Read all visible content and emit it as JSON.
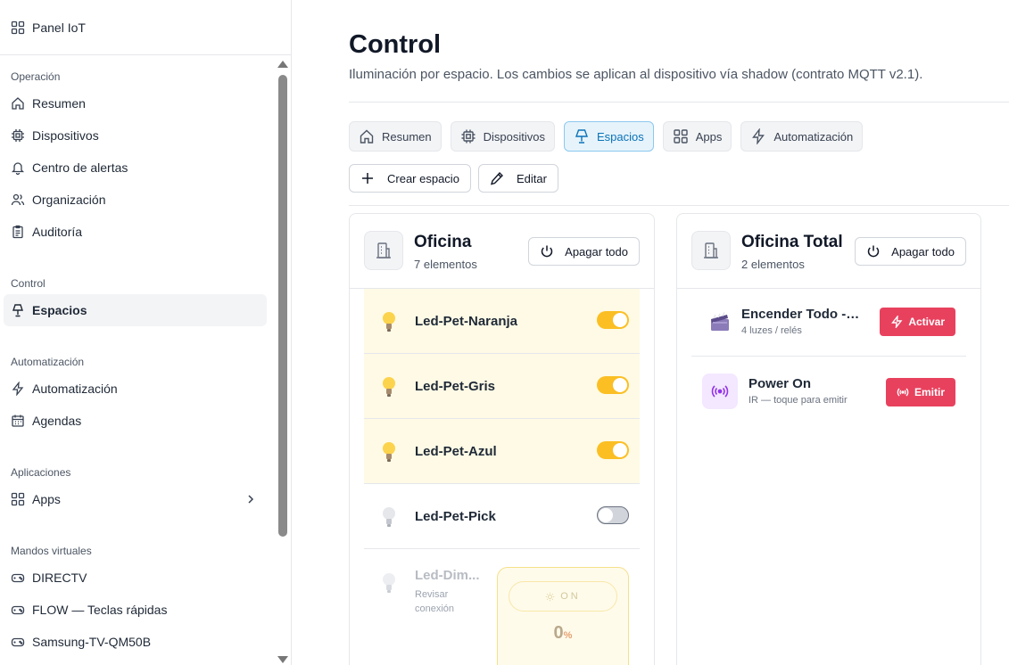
{
  "sidebar": {
    "brand": "Panel IoT",
    "groups": [
      {
        "title": "Operación",
        "items": [
          {
            "label": "Resumen",
            "icon": "home-icon"
          },
          {
            "label": "Dispositivos",
            "icon": "chip-icon"
          },
          {
            "label": "Centro de alertas",
            "icon": "bell-icon"
          },
          {
            "label": "Organización",
            "icon": "users-icon"
          },
          {
            "label": "Auditoría",
            "icon": "clipboard-icon"
          }
        ]
      },
      {
        "title": "Control",
        "items": [
          {
            "label": "Espacios",
            "icon": "lamp-icon",
            "active": true
          }
        ]
      },
      {
        "title": "Automatización",
        "items": [
          {
            "label": "Automatización",
            "icon": "lightning-icon"
          },
          {
            "label": "Agendas",
            "icon": "calendar-icon"
          }
        ]
      },
      {
        "title": "Aplicaciones",
        "items": [
          {
            "label": "Apps",
            "icon": "grid-icon"
          }
        ]
      },
      {
        "title": "Mandos virtuales",
        "items": [
          {
            "label": "DIRECTV",
            "icon": "gamepad-icon"
          },
          {
            "label": "FLOW — Teclas rápidas",
            "icon": "gamepad-icon"
          },
          {
            "label": "Samsung-TV-QM50B",
            "icon": "gamepad-icon"
          }
        ]
      }
    ]
  },
  "header": {
    "title": "Control",
    "subtitle": "Iluminación por espacio. Los cambios se aplican al dispositivo vía shadow (contrato MQTT v2.1)."
  },
  "tabs": [
    {
      "label": "Resumen",
      "icon": "home-icon"
    },
    {
      "label": "Dispositivos",
      "icon": "chip-icon"
    },
    {
      "label": "Espacios",
      "icon": "lamp-icon",
      "active": true
    },
    {
      "label": "Apps",
      "icon": "grid-icon"
    },
    {
      "label": "Automatización",
      "icon": "lightning-icon"
    }
  ],
  "actions": {
    "create_label": "Crear espacio",
    "edit_label": "Editar"
  },
  "spaces": [
    {
      "title": "Oficina",
      "count": "7 elementos",
      "power_label": "Apagar todo",
      "devices": [
        {
          "name": "Led-Pet-Naranja",
          "on": true
        },
        {
          "name": "Led-Pet-Gris",
          "on": true
        },
        {
          "name": "Led-Pet-Azul",
          "on": true
        },
        {
          "name": "Led-Pet-Pick",
          "on": false
        }
      ],
      "dimmer": {
        "name": "Led-Dim...",
        "status": "Revisar conexión",
        "on_label": "ON",
        "value": "0",
        "unit": "%"
      }
    },
    {
      "title": "Oficina Total",
      "count": "2 elementos",
      "power_label": "Apagar todo",
      "scenes": [
        {
          "title": "Encender Todo - I...",
          "sub": "4 luzes / relés",
          "button": "Activar"
        },
        {
          "title": "Power On",
          "sub": "IR — toque para emitir",
          "button": "Emitir"
        }
      ]
    }
  ],
  "colors": {
    "accent": "#0b73b8",
    "toggle_on": "#fbbf24",
    "danger": "#e8415e",
    "row_on_bg": "#fefae5"
  }
}
